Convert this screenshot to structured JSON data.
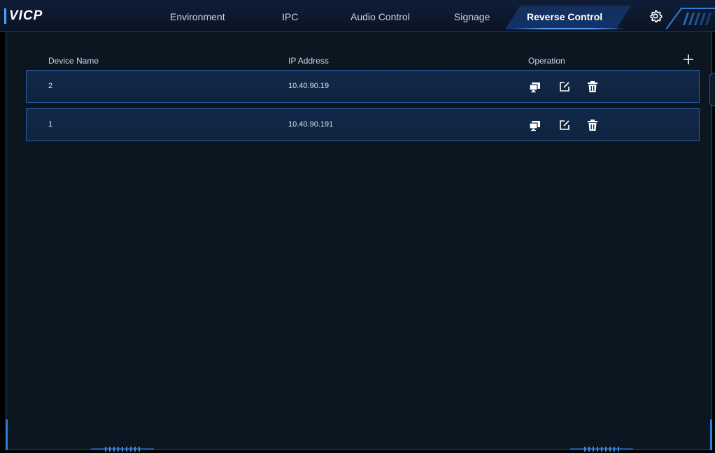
{
  "header": {
    "brand": "VICP",
    "tabs": [
      {
        "label": "Environment",
        "active": false
      },
      {
        "label": "IPC",
        "active": false
      },
      {
        "label": "Audio Control",
        "active": false
      },
      {
        "label": "Signage",
        "active": false
      },
      {
        "label": "Reverse Control",
        "active": true
      }
    ],
    "settings_icon": "gear-icon"
  },
  "table": {
    "columns": [
      "Device Name",
      "IP Address",
      "Operation"
    ],
    "add_icon": "plus-icon",
    "rows": [
      {
        "name": "2",
        "ip": "10.40.90.19"
      },
      {
        "name": "1",
        "ip": "10.40.90.191"
      }
    ],
    "operation_icons": [
      "remote-control-icon",
      "edit-icon",
      "delete-icon"
    ]
  },
  "colors": {
    "accent": "#4fa3ff",
    "background": "#0b1620",
    "row_background": "#13294a",
    "row_border": "#2a5e9e"
  }
}
